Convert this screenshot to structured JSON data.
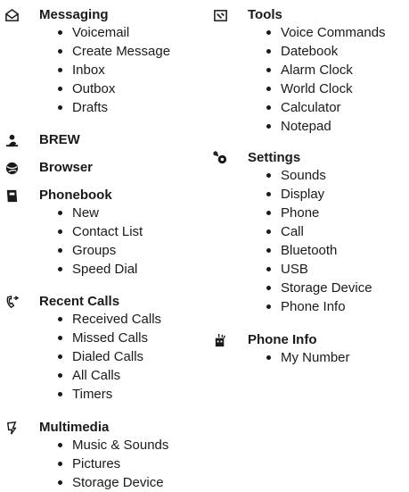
{
  "left": [
    {
      "id": "messaging",
      "icon": "envelope-icon",
      "title": "Messaging",
      "items": [
        "Voicemail",
        "Create Message",
        "Inbox",
        "Outbox",
        "Drafts"
      ]
    },
    {
      "id": "brew",
      "icon": "brew-icon",
      "title": "BREW",
      "items": []
    },
    {
      "id": "browser",
      "icon": "globe-icon",
      "title": "Browser",
      "items": []
    },
    {
      "id": "phonebook",
      "icon": "phonebook-icon",
      "title": "Phonebook",
      "items": [
        "New",
        "Contact List",
        "Groups",
        "Speed Dial"
      ]
    },
    {
      "id": "recent-calls",
      "icon": "recent-calls-icon",
      "title": "Recent Calls",
      "items": [
        "Received Calls",
        "Missed Calls",
        "Dialed Calls",
        "All Calls",
        "Timers"
      ]
    },
    {
      "id": "multimedia",
      "icon": "multimedia-icon",
      "title": "Multimedia",
      "items": [
        "Music & Sounds",
        "Pictures",
        "Storage Device"
      ]
    }
  ],
  "right": [
    {
      "id": "tools",
      "icon": "tools-icon",
      "title": "Tools",
      "items": [
        "Voice Commands",
        "Datebook",
        "Alarm Clock",
        "World Clock",
        "Calculator",
        "Notepad"
      ]
    },
    {
      "id": "settings",
      "icon": "settings-icon",
      "title": "Settings",
      "items": [
        "Sounds",
        "Display",
        "Phone",
        "Call",
        "Bluetooth",
        "USB",
        "Storage Device",
        "Phone Info"
      ]
    },
    {
      "id": "phone-info",
      "icon": "phone-info-icon",
      "title": "Phone Info",
      "items": [
        "My Number"
      ]
    }
  ]
}
